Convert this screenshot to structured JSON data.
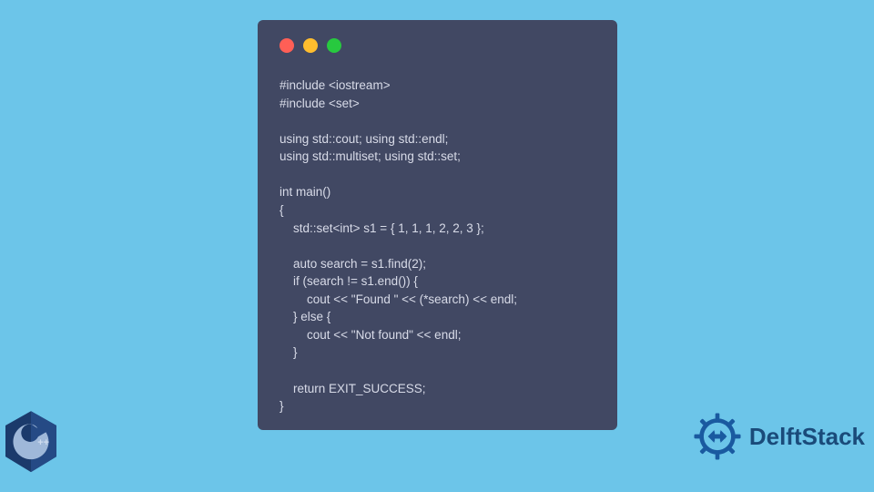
{
  "window": {
    "dots": {
      "red": "#ff5f56",
      "yellow": "#ffbd2e",
      "green": "#27c93f"
    }
  },
  "code": {
    "line1": "#include <iostream>",
    "line2": "#include <set>",
    "line3": "",
    "line4": "using std::cout; using std::endl;",
    "line5": "using std::multiset; using std::set;",
    "line6": "",
    "line7": "int main()",
    "line8": "{",
    "line9": "    std::set<int> s1 = { 1, 1, 1, 2, 2, 3 };",
    "line10": "",
    "line11": "    auto search = s1.find(2);",
    "line12": "    if (search != s1.end()) {",
    "line13": "        cout << \"Found \" << (*search) << endl;",
    "line14": "    } else {",
    "line15": "        cout << \"Not found\" << endl;",
    "line16": "    }",
    "line17": "",
    "line18": "    return EXIT_SUCCESS;",
    "line19": "}"
  },
  "branding": {
    "cpp_label": "C++",
    "site_name": "DelftStack"
  }
}
